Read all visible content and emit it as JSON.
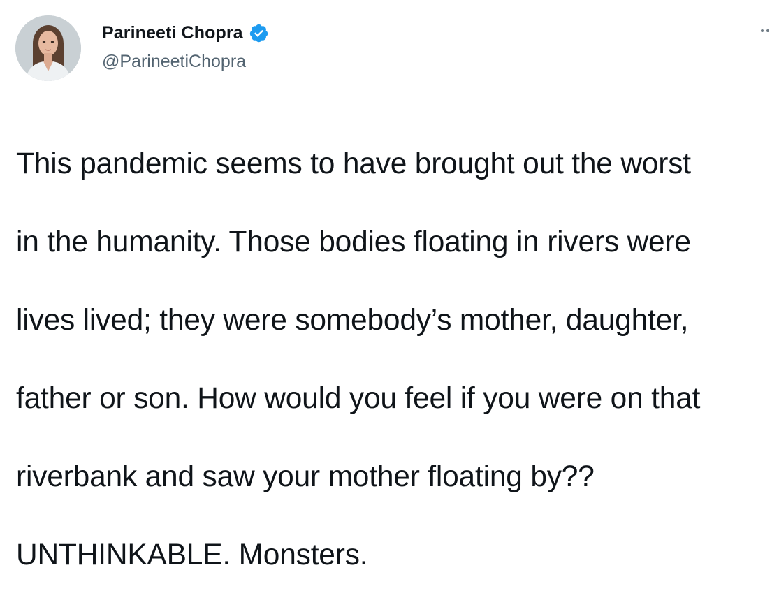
{
  "user": {
    "display_name": "Parineeti Chopra",
    "handle": "@ParineetiChopra",
    "verified": true,
    "verified_color": "#1d9bf0"
  },
  "tweet": {
    "lines": [
      "This pandemic seems to have brought out the worst",
      "in the humanity. Those bodies floating in rivers were",
      "lives lived; they were somebody’s mother, daughter,",
      "father or son. How would you feel if you were on that",
      "riverbank and saw your mother floating by??",
      "UNTHINKABLE. Monsters."
    ]
  },
  "icons": {
    "more": "more-options-icon",
    "verified": "verified-badge-icon"
  },
  "colors": {
    "text_primary": "#0f1419",
    "text_secondary": "#536471",
    "background": "#ffffff"
  }
}
